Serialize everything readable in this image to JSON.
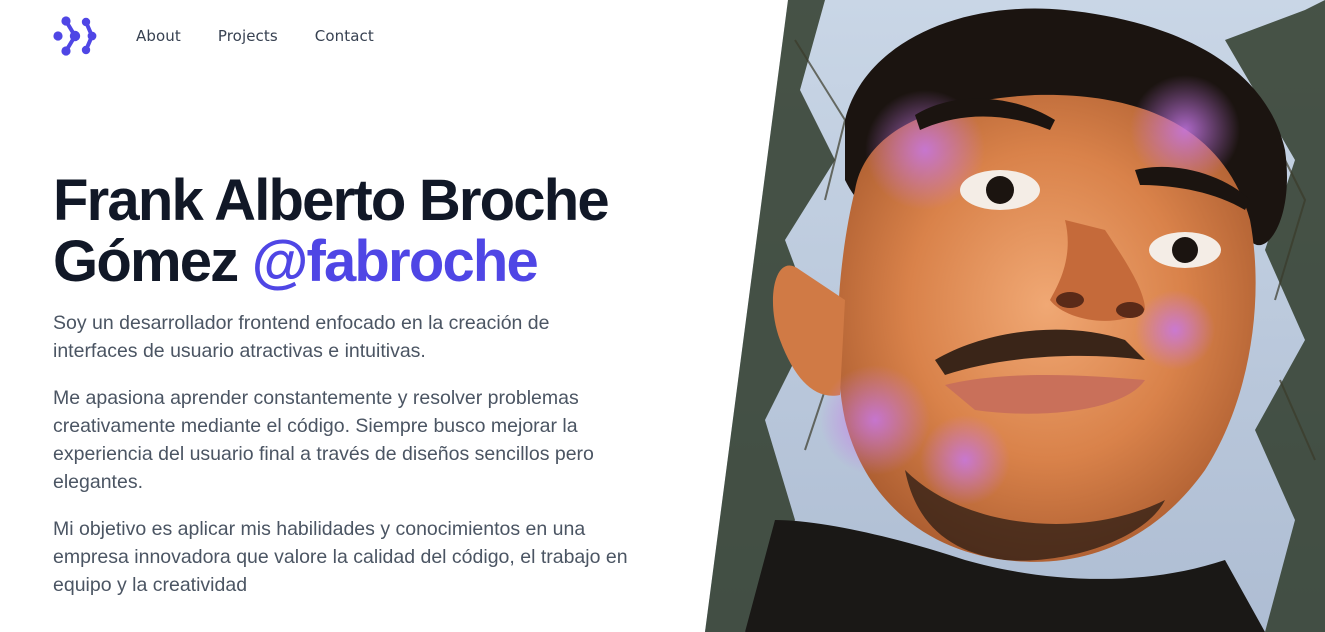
{
  "nav": {
    "logo": "logo-mark",
    "links": [
      {
        "label": "About"
      },
      {
        "label": "Projects"
      },
      {
        "label": "Contact"
      }
    ]
  },
  "hero": {
    "title_line1": "Frank Alberto Broche",
    "title_line2": "Gómez",
    "handle": "@fabroche",
    "paragraphs": [
      "Soy un desarrollador frontend enfocado en la creación de interfaces de usuario atractivas e intuitivas.",
      "Me apasiona aprender constantemente y resolver problemas creativamente mediante el código. Siempre busco mejorar la experiencia del usuario final a través de diseños sencillos pero elegantes.",
      "Mi objetivo es aplicar mis habilidades y conocimientos en una empresa innovadora que valore la calidad del código, el trabajo en equipo y la creatividad"
    ]
  },
  "colors": {
    "accent": "#4f46e5",
    "heading": "#111827",
    "body_text": "#4b5563",
    "nav_text": "#374151"
  },
  "image": {
    "subject": "stylized-portrait-photo"
  }
}
